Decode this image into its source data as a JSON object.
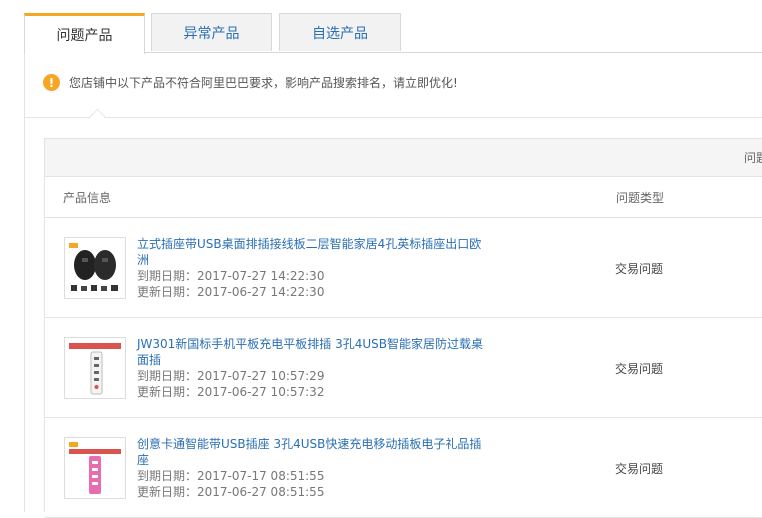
{
  "tabs": [
    {
      "label": "问题产品",
      "active": true
    },
    {
      "label": "异常产品",
      "active": false
    },
    {
      "label": "自选产品",
      "active": false
    }
  ],
  "notice": {
    "icon": "warning-icon",
    "text": "您店铺中以下产品不符合阿里巴巴要求，影响产品搜索排名，请立即优化!"
  },
  "summary": {
    "text": "问题"
  },
  "table": {
    "headers": {
      "product": "产品信息",
      "type": "问题类型"
    },
    "rows": [
      {
        "title": "立式插座带USB桌面排插接线板二层智能家居4孔英标插座出口欧洲",
        "expire": "到期日期：2017-07-27 14:22:30",
        "update": "更新日期：2017-06-27 14:22:30",
        "type": "交易问题"
      },
      {
        "title": "JW301新国标手机平板充电平板排插 3孔4USB智能家居防过载桌面插",
        "expire": "到期日期：2017-07-27 10:57:29",
        "update": "更新日期：2017-06-27 10:57:32",
        "type": "交易问题"
      },
      {
        "title": "创意卡通智能带USB插座 3孔4USB快速充电移动插板电子礼品插座",
        "expire": "到期日期：2017-07-17 08:51:55",
        "update": "更新日期：2017-06-27 08:51:55",
        "type": "交易问题"
      }
    ]
  },
  "colors": {
    "accent": "#f5a623",
    "link": "#2a6fb3"
  }
}
